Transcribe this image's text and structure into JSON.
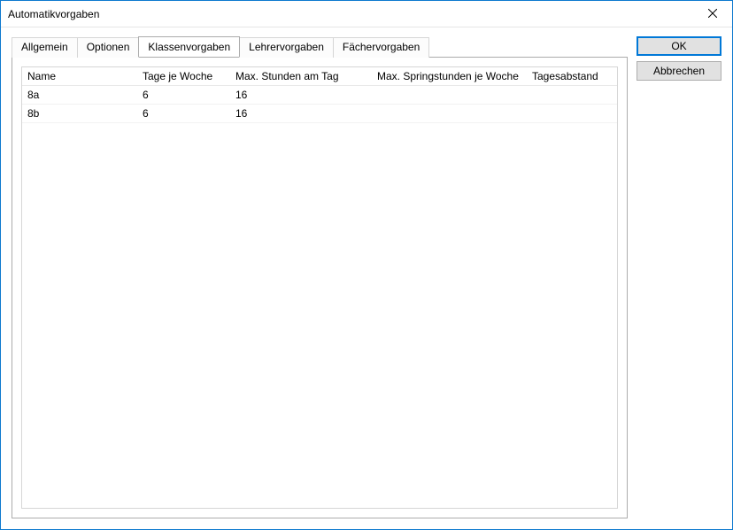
{
  "window": {
    "title": "Automatikvorgaben"
  },
  "buttons": {
    "ok": "OK",
    "cancel": "Abbrechen"
  },
  "tabs": {
    "allgemein": "Allgemein",
    "optionen": "Optionen",
    "klassenvorgaben": "Klassenvorgaben",
    "lehrervorgaben": "Lehrervorgaben",
    "faechervorgaben": "Fächervorgaben",
    "active": "klassenvorgaben"
  },
  "headers": {
    "name": "Name",
    "tage_je_woche": "Tage je Woche",
    "max_stunden_am_tag": "Max. Stunden am Tag",
    "max_springstunden_je_woche": "Max. Springstunden je Woche",
    "tagesabstand": "Tagesabstand"
  },
  "rows": [
    {
      "name": "8a",
      "tage_je_woche": "6",
      "max_stunden_am_tag": "16",
      "max_springstunden_je_woche": "",
      "tagesabstand": ""
    },
    {
      "name": "8b",
      "tage_je_woche": "6",
      "max_stunden_am_tag": "16",
      "max_springstunden_je_woche": "",
      "tagesabstand": ""
    }
  ]
}
